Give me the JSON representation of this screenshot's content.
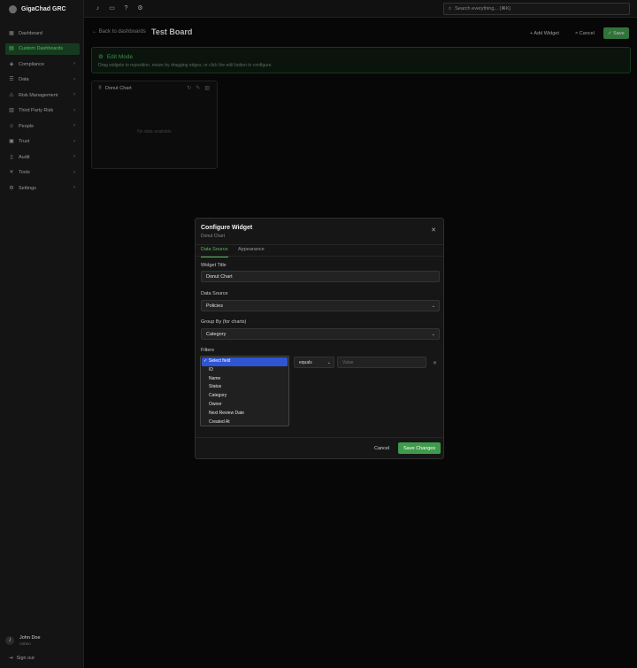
{
  "app": {
    "name": "GigaChad GRC"
  },
  "sidebar": {
    "items": [
      {
        "label": "Dashboard",
        "icon": "grid-icon",
        "chevron": false
      },
      {
        "label": "Custom Dashboards",
        "icon": "layout-icon",
        "chevron": false,
        "active": true
      },
      {
        "label": "Compliance",
        "icon": "check-shield-icon",
        "chevron": true
      },
      {
        "label": "Data",
        "icon": "database-icon",
        "chevron": true
      },
      {
        "label": "Risk Management",
        "icon": "alert-icon",
        "chevron": true
      },
      {
        "label": "Third Party Risk",
        "icon": "building-icon",
        "chevron": true
      },
      {
        "label": "People",
        "icon": "users-icon",
        "chevron": true
      },
      {
        "label": "Trust",
        "icon": "lock-icon",
        "chevron": true
      },
      {
        "label": "Audit",
        "icon": "clipboard-icon",
        "chevron": true
      },
      {
        "label": "Tools",
        "icon": "wrench-icon",
        "chevron": true
      },
      {
        "label": "Settings",
        "icon": "gear-icon",
        "chevron": true
      }
    ],
    "user": {
      "initial": "J",
      "name": "John Doe",
      "role": "Admin"
    },
    "signout_label": "Sign out"
  },
  "topbar": {
    "search_placeholder": "Search everything... (⌘K)"
  },
  "header": {
    "back_label": "← Back to dashboards",
    "title": "Test Board",
    "add_widget_label": "+ Add Widget",
    "cancel_label": "× Cancel",
    "save_label": "✓ Save"
  },
  "banner": {
    "title": "Edit Mode",
    "description": "Drag widgets to reposition, resize by dragging edges, or click the edit button to configure."
  },
  "widget": {
    "title": "Donut Chart",
    "empty_text": "No data available"
  },
  "modal": {
    "title": "Configure Widget",
    "subtitle": "Donut Chart",
    "tabs": [
      "Data Source",
      "Appearance"
    ],
    "widget_title_label": "Widget Title",
    "widget_title_value": "Donut Chart",
    "data_source_label": "Data Source",
    "data_source_value": "Policies",
    "group_by_label": "Group By (for charts)",
    "group_by_value": "Category",
    "filters_label": "Filters",
    "operator_value": "equals",
    "value_placeholder": "Value",
    "field_options": [
      "Select field",
      "ID",
      "Name",
      "Status",
      "Category",
      "Owner",
      "Next Review Date",
      "Created At"
    ],
    "cancel_label": "Cancel",
    "save_label": "Save Changes"
  },
  "colors": {
    "accent": "#4fbf5f",
    "button_green": "#3f9b4b",
    "selected_option": "#2f55d4",
    "background": "#0a0a0a"
  }
}
